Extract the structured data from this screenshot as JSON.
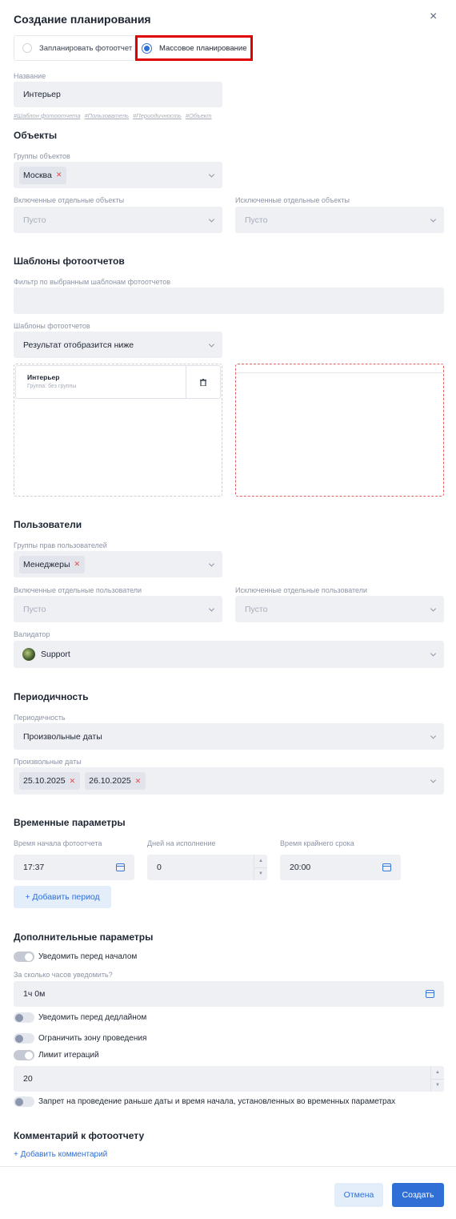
{
  "modal": {
    "title": "Создание планирования",
    "close_glyph": "×"
  },
  "mode": {
    "option_single": "Запланировать фотоотчет",
    "option_mass": "Массовое планирование",
    "selected": "mass"
  },
  "name": {
    "label": "Название",
    "value": "Интерьер",
    "hints": [
      "#Шаблон фотоотчета",
      "#Пользователь",
      "#Периодичность",
      "#Объект"
    ]
  },
  "objects": {
    "heading": "Объекты",
    "groups_label": "Группы объектов",
    "groups_chips": [
      "Москва"
    ],
    "included_label": "Включенные отдельные объекты",
    "included_value": "Пусто",
    "excluded_label": "Исключенные отдельные объекты",
    "excluded_value": "Пусто"
  },
  "templates": {
    "heading": "Шаблоны фотоотчетов",
    "filter_label": "Фильтр по выбранным шаблонам фотоотчетов",
    "filter_value": "",
    "select_label": "Шаблоны фотоотчетов",
    "select_value": "Результат отобразится ниже",
    "card_title": "Интерьер",
    "card_subtitle": "Группа: без группы"
  },
  "users": {
    "heading": "Пользователи",
    "groups_label": "Группы прав пользователей",
    "groups_chips": [
      "Менеджеры"
    ],
    "included_label": "Включенные отдельные пользователи",
    "included_value": "Пусто",
    "excluded_label": "Исключенные отдельные пользователи",
    "excluded_value": "Пусто",
    "validator_label": "Валидатор",
    "validator_value": "Support"
  },
  "periodicity": {
    "heading": "Периодичность",
    "period_label": "Периодичность",
    "period_value": "Произвольные даты",
    "dates_label": "Произвольные даты",
    "dates_chips": [
      "25.10.2025",
      "26.10.2025"
    ]
  },
  "time": {
    "heading": "Временные параметры",
    "start_label": "Время начала фотоотчета",
    "start_value": "17:37",
    "days_label": "Дней на исполнение",
    "days_value": "0",
    "deadline_label": "Время крайнего срока",
    "deadline_value": "20:00",
    "add_period": "+ Добавить период"
  },
  "extra": {
    "heading": "Дополнительные параметры",
    "notify_start": "Уведомить перед началом",
    "notify_start_on": true,
    "hours_label": "За сколько часов уведомить?",
    "hours_value": "1ч 0м",
    "notify_deadline": "Уведомить перед дедлайном",
    "notify_deadline_on": false,
    "limit_zone": "Ограничить зону проведения",
    "limit_zone_on": false,
    "iteration_limit": "Лимит итераций",
    "iteration_limit_on": true,
    "iteration_value": "20",
    "forbid_early": "Запрет на проведение раньше даты и время начала, установленных во временных параметрах",
    "forbid_early_on": false
  },
  "comment": {
    "heading": "Комментарий к фотоотчету",
    "add": "+ Добавить комментарий"
  },
  "footer": {
    "cancel": "Отмена",
    "create": "Создать"
  },
  "colors": {
    "accent": "#2f6fd6",
    "highlight": "#e00000",
    "field_bg": "#eef0f4"
  }
}
